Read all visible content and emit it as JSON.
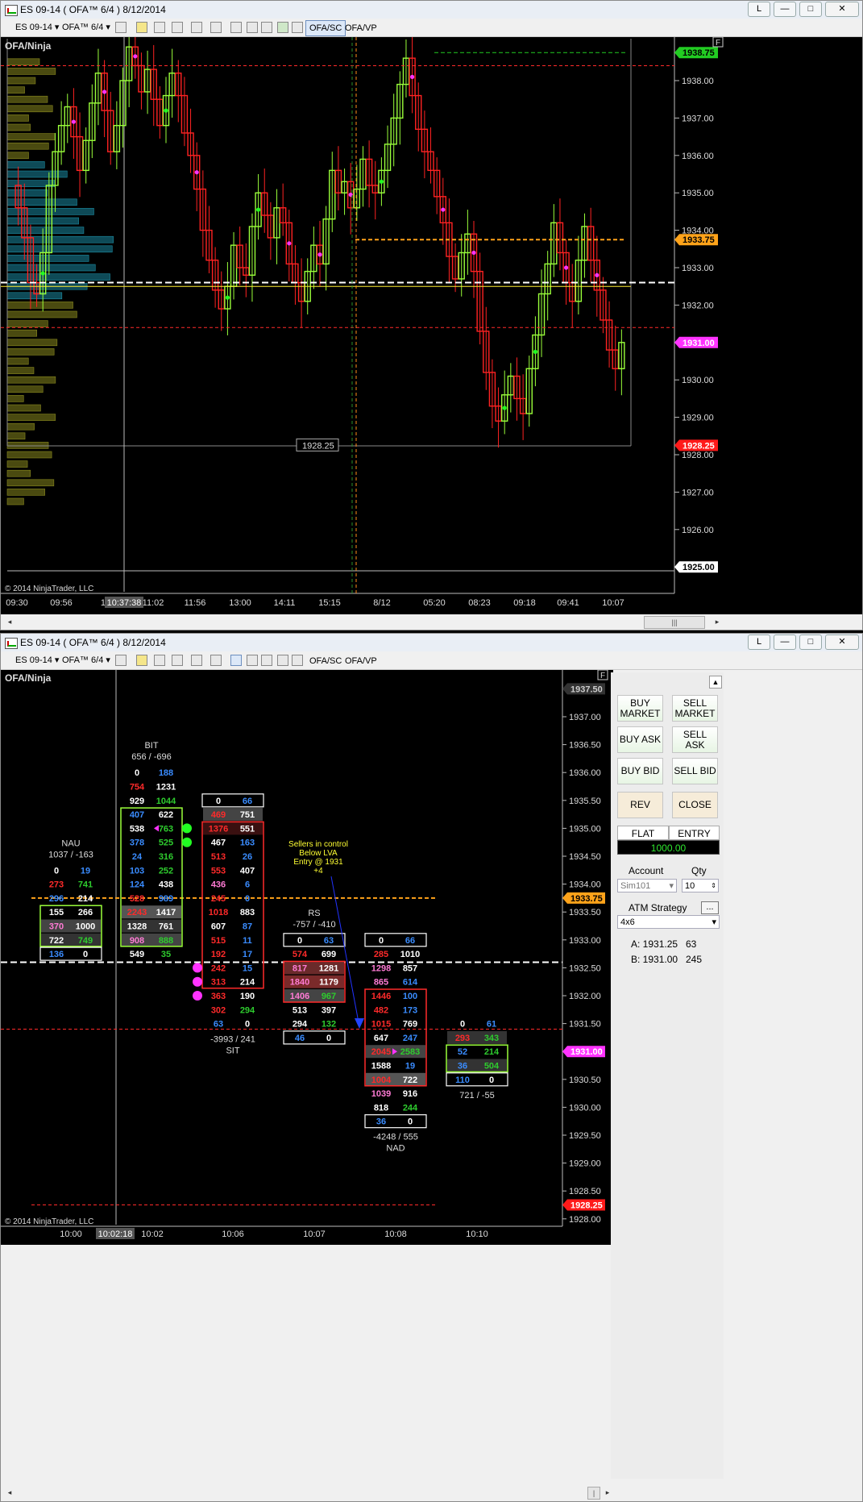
{
  "window1": {
    "title": "ES 09-14 ( OFA™ 6/4 )  8/12/2014",
    "toolbar": {
      "instrument": "ES 09-14",
      "period": "OFA™ 6/4",
      "btn_sc": "OFA/SC",
      "btn_vp": "OFA/VP"
    },
    "chart_label": "OFA/Ninja",
    "copyright": "© 2014 NinjaTrader, LLC",
    "price_axis": [
      "1938.00",
      "1937.00",
      "1936.00",
      "1935.00",
      "1934.00",
      "1933.00",
      "1932.00",
      "1931.00",
      "1930.00",
      "1929.00",
      "1928.00",
      "1927.00",
      "1926.00",
      "1925.00"
    ],
    "price_markers": {
      "top": "1938.75",
      "orange": "1933.75",
      "magenta": "1931.00",
      "red": "1928.25",
      "white": "1925.00"
    },
    "inner_label": "1928.25",
    "time_axis": [
      "09:30",
      "09:56",
      "10",
      "11:02",
      "11:56",
      "13:00",
      "14:11",
      "15:15",
      "8/12",
      "05:20",
      "08:23",
      "09:18",
      "09:41",
      "10:07"
    ],
    "cursor_time": "10:37:38"
  },
  "window2": {
    "title": "ES 09-14 ( OFA™ 6/4 )  8/12/2014",
    "toolbar": {
      "instrument": "ES 09-14",
      "period": "OFA™ 6/4",
      "btn_sc": "OFA/SC",
      "btn_vp": "OFA/VP"
    },
    "chart_label": "OFA/Ninja",
    "copyright": "© 2014 NinjaTrader, LLC",
    "price_axis": [
      "1937.00",
      "1936.50",
      "1936.00",
      "1935.50",
      "1935.00",
      "1934.50",
      "1934.00",
      "1933.50",
      "1933.00",
      "1932.50",
      "1932.00",
      "1931.50",
      "1931.00",
      "1930.50",
      "1930.00",
      "1929.50",
      "1929.00",
      "1928.50",
      "1928.00"
    ],
    "price_markers": {
      "top": "1937.50",
      "orange": "1933.75",
      "magenta": "1931.00",
      "red": "1928.25"
    },
    "time_axis": [
      "10:00",
      "10:02",
      "10:06",
      "10:07",
      "10:08",
      "10:10"
    ],
    "cursor_time": "10:02:18",
    "annotation": [
      "Sellers in control",
      "Below LVA",
      "Entry @ 1931",
      "+4"
    ],
    "groups": {
      "nau": {
        "name": "NAU",
        "stats": "1037 / -163"
      },
      "bit": {
        "name": "BIT",
        "stats": "656 / -696"
      },
      "sit": {
        "name": "SIT",
        "stats": "-3993 / 241"
      },
      "rs": {
        "name": "RS",
        "stats": "-757 / -410"
      },
      "nad": {
        "name": "NAD",
        "stats": "-4248 / 555"
      },
      "last": {
        "stats": "721 / -55"
      }
    }
  },
  "order_panel": {
    "buy_market": "BUY MARKET",
    "sell_market": "SELL MARKET",
    "buy_ask": "BUY ASK",
    "sell_ask": "SELL ASK",
    "buy_bid": "BUY BID",
    "sell_bid": "SELL BID",
    "rev": "REV",
    "close": "CLOSE",
    "flat": "FLAT",
    "entry": "ENTRY",
    "pnl": "1000.00",
    "account_label": "Account",
    "qty_label": "Qty",
    "account_value": "Sim101",
    "qty_value": "10",
    "atm_label": "ATM Strategy",
    "atm_value": "4x6",
    "atm_btn": "...",
    "ask_label": "A: 1931.25",
    "ask_size": "63",
    "bid_label": "B: 1931.00",
    "bid_size": "245"
  },
  "colors": {
    "bull": "#9aff3a",
    "bear": "#ff2222",
    "orange": "#ffa31a",
    "magenta": "#ff33ff",
    "blue": "#3a8cff",
    "green": "#2ecc2e"
  }
}
